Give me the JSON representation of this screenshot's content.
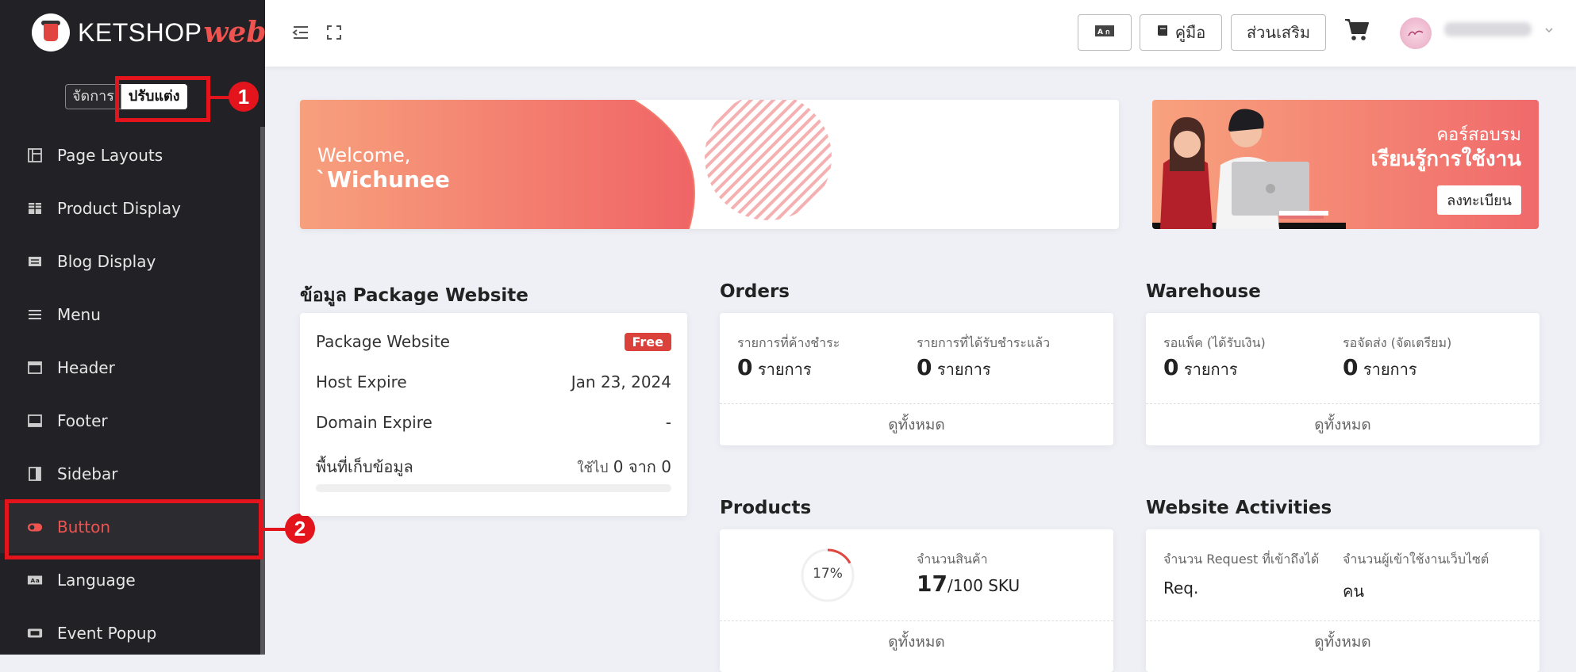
{
  "brand": {
    "logo_main": "KETSHOP",
    "logo_accent": "web",
    "accent": "#ef5350"
  },
  "mode_switch": {
    "manage": "จัดการ",
    "customize": "ปรับแต่ง"
  },
  "markers": {
    "one": "1",
    "two": "2"
  },
  "nav": [
    {
      "label": "Page Layouts",
      "icon": "page-layout-icon"
    },
    {
      "label": "Product Display",
      "icon": "grid-icon"
    },
    {
      "label": "Blog Display",
      "icon": "blog-icon"
    },
    {
      "label": "Menu",
      "icon": "hamburger-icon"
    },
    {
      "label": "Header",
      "icon": "header-icon"
    },
    {
      "label": "Footer",
      "icon": "footer-icon"
    },
    {
      "label": "Sidebar",
      "icon": "sidebar-icon"
    },
    {
      "label": "Button",
      "icon": "toggle-icon",
      "active": true
    },
    {
      "label": "Language",
      "icon": "language-icon"
    },
    {
      "label": "Event Popup",
      "icon": "popup-icon"
    }
  ],
  "topbar": {
    "manual": "คู่มือ",
    "addons": "ส่วนเสริม"
  },
  "welcome": {
    "line1": "Welcome,",
    "line2": "`Wichunee"
  },
  "course": {
    "line1": "คอร์สอบรม",
    "line2": "เรียนรู้การใช้งาน",
    "button": "ลงทะเบียน"
  },
  "package": {
    "title": "ข้อมูล Package Website",
    "plan_label": "Package Website",
    "plan_value": "Free",
    "host_label": "Host Expire",
    "host_value": "Jan 23, 2024",
    "domain_label": "Domain Expire",
    "domain_value": "-",
    "storage_label": "พื้นที่เก็บข้อมูล",
    "storage_prefix": "ใช้ไป",
    "storage_used": "0",
    "storage_mid": "จาก",
    "storage_total": "0",
    "storage_fraction": 0
  },
  "orders": {
    "title": "Orders",
    "pending_label": "รายการที่ค้างชำระ",
    "pending_value": "0",
    "pending_unit": "รายการ",
    "paid_label": "รายการที่ได้รับชำระแล้ว",
    "paid_value": "0",
    "paid_unit": "รายการ",
    "view_all": "ดูทั้งหมด"
  },
  "warehouse": {
    "title": "Warehouse",
    "pack_label": "รอแพ็ค (ได้รับเงิน)",
    "pack_value": "0",
    "pack_unit": "รายการ",
    "ship_label": "รอจัดส่ง (จัดเตรียม)",
    "ship_value": "0",
    "ship_unit": "รายการ",
    "view_all": "ดูทั้งหมด"
  },
  "products": {
    "title": "Products",
    "percent_text": "17%",
    "percent": 17,
    "count_label": "จำนวนสินค้า",
    "count_value": "17",
    "count_total": "/100 SKU",
    "view_all": "ดูทั้งหมด"
  },
  "activities": {
    "title": "Website Activities",
    "req_label": "จำนวน Request ที่เข้าถึงได้",
    "req_value": "Req.",
    "visitors_label": "จำนวนผู้เข้าใช้งานเว็บไซต์",
    "visitors_value": "คน",
    "view_all": "ดูทั้งหมด"
  }
}
